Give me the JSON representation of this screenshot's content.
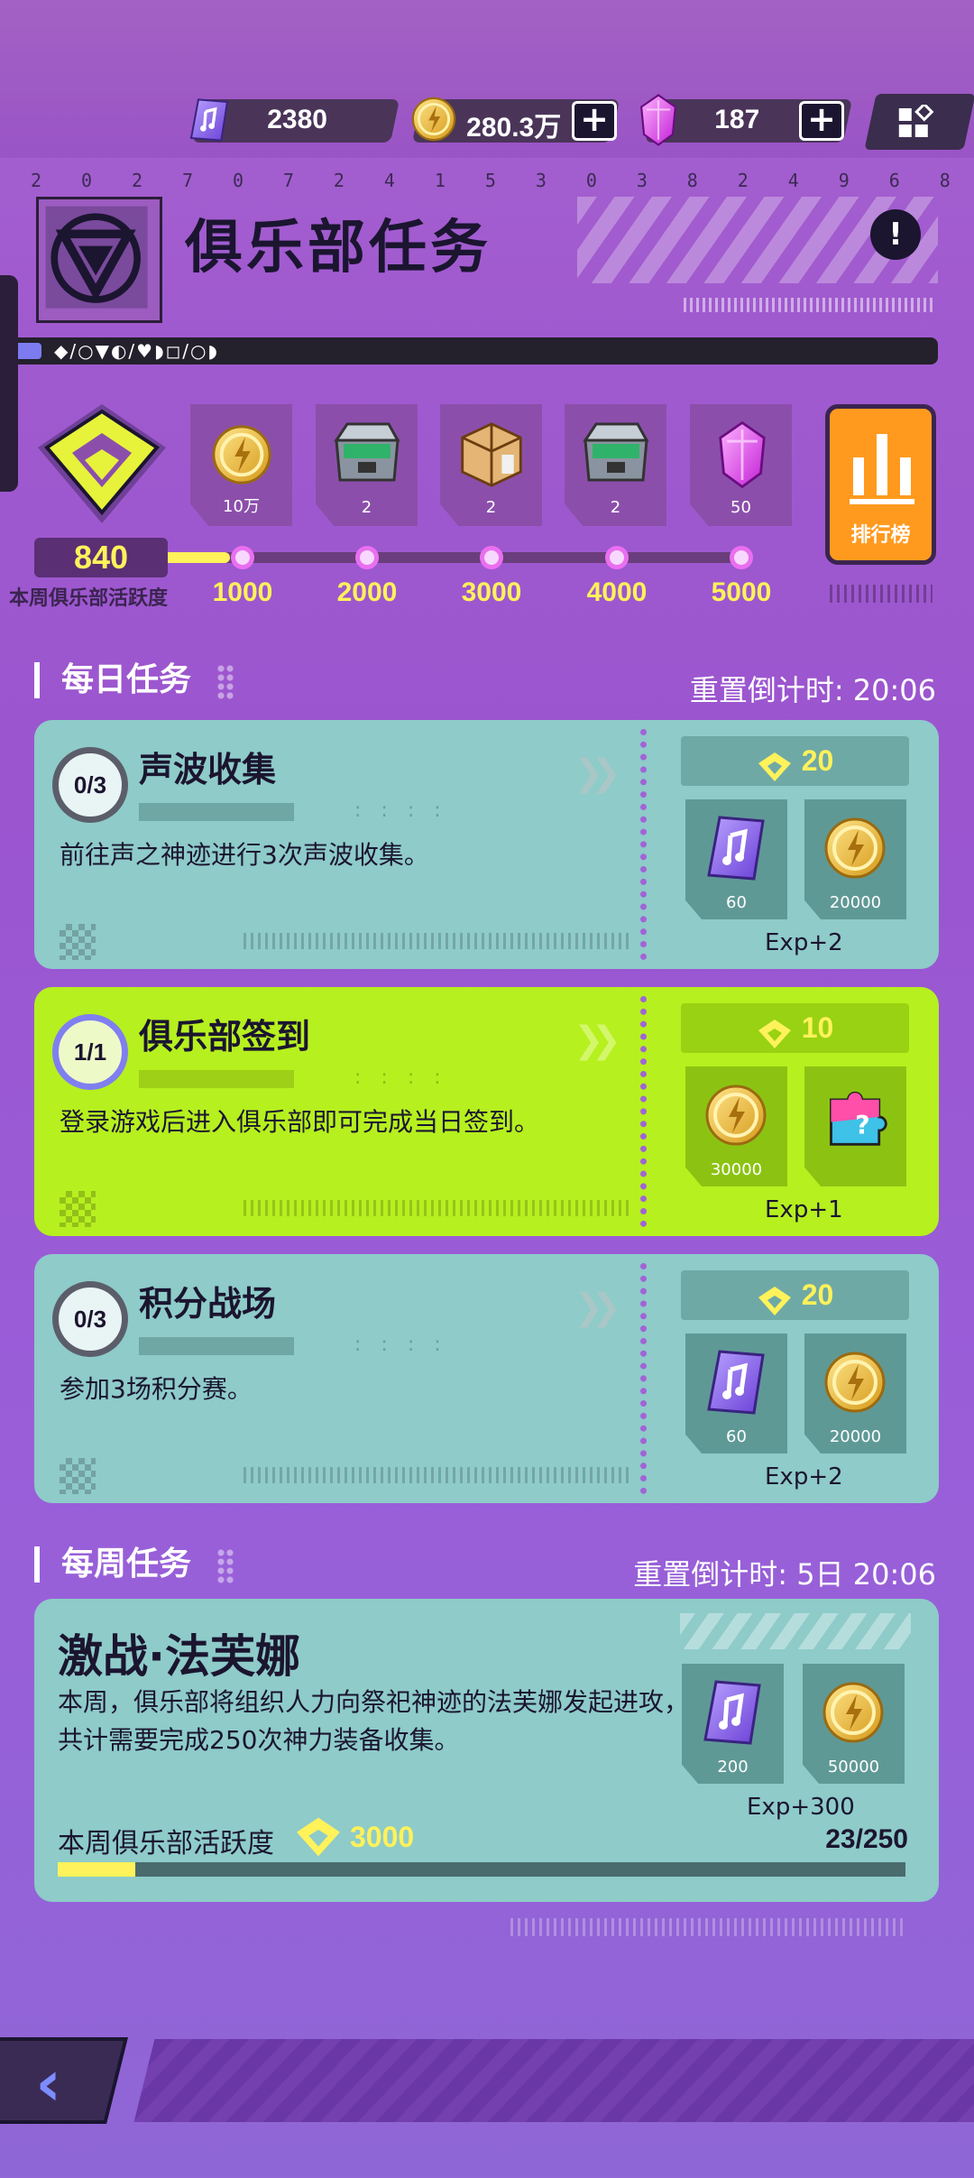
{
  "currency": {
    "tickets": "2380",
    "coins": "280.3万",
    "gems": "187"
  },
  "header": {
    "serial_digits": [
      "2",
      "0",
      "2",
      "7",
      "0",
      "7",
      "2",
      "4",
      "1",
      "5",
      "3",
      "0",
      "3",
      "8",
      "2",
      "4",
      "9",
      "6",
      "8"
    ],
    "title": "俱乐部任务",
    "info_label": "!",
    "symbol_bar": "◆/○▼◐/♥◗◻/○◗"
  },
  "activity": {
    "score": "840",
    "label": "本周俱乐部活跃度",
    "progress_fraction": 0.12,
    "milestones": [
      {
        "value": "1000",
        "reward": "coin",
        "count": "10万"
      },
      {
        "value": "2000",
        "reward": "chest",
        "count": "2"
      },
      {
        "value": "3000",
        "reward": "box",
        "count": "2"
      },
      {
        "value": "4000",
        "reward": "chest",
        "count": "2"
      },
      {
        "value": "5000",
        "reward": "gem",
        "count": "50"
      }
    ],
    "rank_label": "排行榜"
  },
  "daily": {
    "title": "每日任务",
    "timer": "重置倒计时: 20:06",
    "tasks": [
      {
        "progress": "0/3",
        "name": "声波收集",
        "desc": "前往声之神迹进行3次声波收集。",
        "points": "20",
        "rewards": [
          {
            "icon": "ticket-icon",
            "count": "60"
          },
          {
            "icon": "coin-icon",
            "count": "20000"
          }
        ],
        "exp": "Exp+2"
      },
      {
        "progress": "1/1",
        "name": "俱乐部签到",
        "desc": "登录游戏后进入俱乐部即可完成当日签到。",
        "points": "10",
        "rewards": [
          {
            "icon": "coin-icon",
            "count": "30000"
          },
          {
            "icon": "puzzle-icon",
            "count": ""
          }
        ],
        "exp": "Exp+1"
      },
      {
        "progress": "0/3",
        "name": "积分战场",
        "desc": "参加3场积分赛。",
        "points": "20",
        "rewards": [
          {
            "icon": "ticket-icon",
            "count": "60"
          },
          {
            "icon": "coin-icon",
            "count": "20000"
          }
        ],
        "exp": "Exp+2"
      }
    ]
  },
  "weekly": {
    "title": "每周任务",
    "timer": "重置倒计时: 5日 20:06",
    "task": {
      "name": "激战·法芙娜",
      "desc": "本周，俱乐部将组织人力向祭祀神迹的法芙娜发起进攻，共计需要完成250次神力装备收集。",
      "rewards": [
        {
          "icon": "ticket-icon",
          "count": "200"
        },
        {
          "icon": "coin-icon",
          "count": "50000"
        }
      ],
      "exp": "Exp+300",
      "activity_label": "本周俱乐部活跃度",
      "activity_value": "3000",
      "progress": "23/250",
      "progress_fraction": 0.092
    }
  },
  "footer": {
    "back_label": "‹"
  }
}
